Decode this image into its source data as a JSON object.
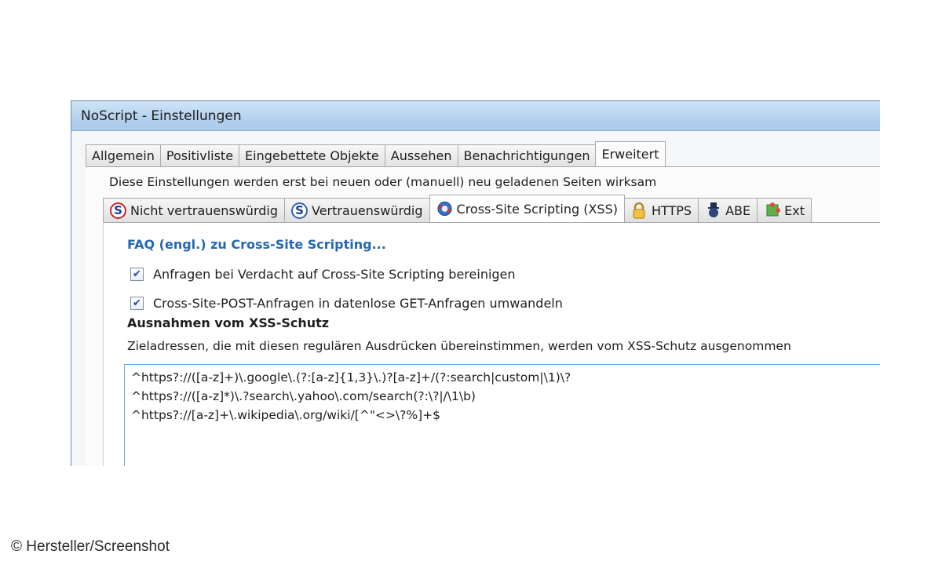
{
  "window": {
    "title": "NoScript - Einstellungen"
  },
  "tabs": [
    {
      "label": "Allgemein",
      "active": false
    },
    {
      "label": "Positivliste",
      "active": false
    },
    {
      "label": "Eingebettete Objekte",
      "active": false
    },
    {
      "label": "Aussehen",
      "active": false
    },
    {
      "label": "Benachrichtigungen",
      "active": false
    },
    {
      "label": "Erweitert",
      "active": true
    }
  ],
  "notice": "Diese Einstellungen werden erst bei neuen oder (manuell) neu geladenen Seiten wirksam",
  "subtabs": [
    {
      "label": "Nicht vertrauenswürdig",
      "icon": "s-red-icon",
      "active": false
    },
    {
      "label": "Vertrauenswürdig",
      "icon": "s-blue-icon",
      "active": false
    },
    {
      "label": "Cross-Site Scripting (XSS)",
      "icon": "xss-shield-icon",
      "active": true
    },
    {
      "label": "HTTPS",
      "icon": "lock-icon",
      "active": false
    },
    {
      "label": "ABE",
      "icon": "abe-icon",
      "active": false
    },
    {
      "label": "Ext",
      "icon": "puzzle-icon",
      "active": false
    }
  ],
  "xss": {
    "faq_link": "FAQ (engl.) zu Cross-Site Scripting...",
    "checkbox_sanitize": {
      "label": "Anfragen bei Verdacht auf Cross-Site Scripting bereinigen",
      "checked": true
    },
    "checkbox_post": {
      "label": "Cross-Site-POST-Anfragen in datenlose GET-Anfragen umwandeln",
      "checked": true
    },
    "exceptions_heading": "Ausnahmen vom XSS-Schutz",
    "exceptions_description": "Zieladressen, die mit diesen regulären Ausdrücken übereinstimmen, werden vom XSS-Schutz ausgenommen",
    "exceptions_lines": [
      "^https?://([a-z]+)\\.google\\.(?:[a-z]{1,3}\\.)?[a-z]+/(?:search|custom|\\1)\\?",
      "^https?://([a-z]*)\\.?search\\.yahoo\\.com/search(?:\\?|/\\1\\b)",
      "^https?://[a-z]+\\.wikipedia\\.org/wiki/[^\"<>\\?%]+$"
    ]
  },
  "credit": "© Hersteller/Screenshot",
  "colors": {
    "titlebar": "#b6d3ee",
    "link": "#2467b3",
    "textarea_border": "#6fa6dc"
  }
}
